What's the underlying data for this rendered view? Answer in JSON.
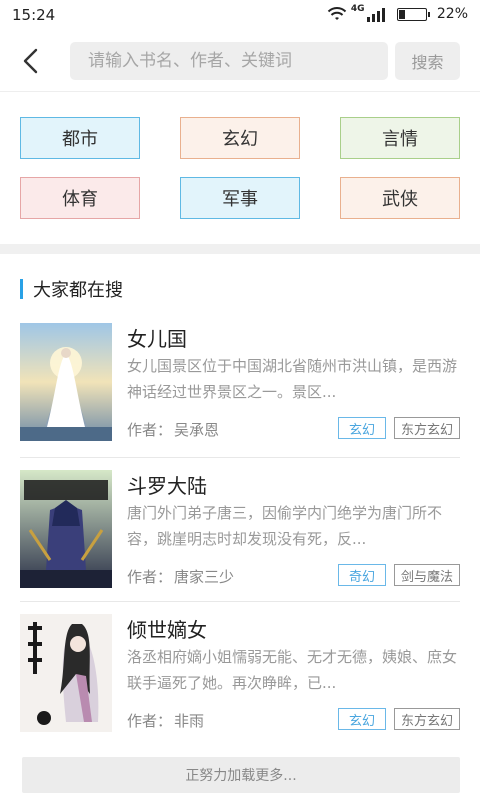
{
  "status_bar": {
    "time": "15:24",
    "network": "4G",
    "battery_percent": "22%",
    "battery_level": 0.22
  },
  "search": {
    "placeholder": "请输入书名、作者、关键词",
    "button_label": "搜索"
  },
  "categories": [
    {
      "label": "都市",
      "bg": "#e2f4fb",
      "border": "#5fb9e4"
    },
    {
      "label": "玄幻",
      "bg": "#fcf1ea",
      "border": "#e9b08e"
    },
    {
      "label": "言情",
      "bg": "#eef5e8",
      "border": "#a9cf8a"
    },
    {
      "label": "体育",
      "bg": "#fbeaea",
      "border": "#e6a6a6"
    },
    {
      "label": "军事",
      "bg": "#e2f4fb",
      "border": "#5fb9e4"
    },
    {
      "label": "武侠",
      "bg": "#fcf1ea",
      "border": "#e9b08e"
    }
  ],
  "section": {
    "title": "大家都在搜",
    "accent": "#29a1e6"
  },
  "books": [
    {
      "title": "女儿国",
      "description": "女儿国景区位于中国湖北省随州市洪山镇，是西游神话经过世界景区之一。景区...",
      "author_label": "作者：",
      "author": "吴承恩",
      "tags": [
        "玄幻",
        "东方玄幻"
      ],
      "cover_icon": "bride-on-stairs-cover"
    },
    {
      "title": "斗罗大陆",
      "description": "唐门外门弟子唐三，因偷学内门绝学为唐门所不容，跳崖明志时却发现没有死，反...",
      "author_label": "作者：",
      "author": "唐家三少",
      "tags": [
        "奇幻",
        "剑与魔法"
      ],
      "cover_icon": "anime-warrior-cover"
    },
    {
      "title": "倾世嫡女",
      "description": "洛丞相府嫡小姐懦弱无能、无才无德，姨娘、庶女联手逼死了她。再次睁眸，已...",
      "author_label": "作者：",
      "author": "非雨",
      "tags": [
        "玄幻",
        "东方玄幻"
      ],
      "cover_icon": "ink-painting-lady-cover"
    }
  ],
  "load_more": "正努力加载更多..."
}
